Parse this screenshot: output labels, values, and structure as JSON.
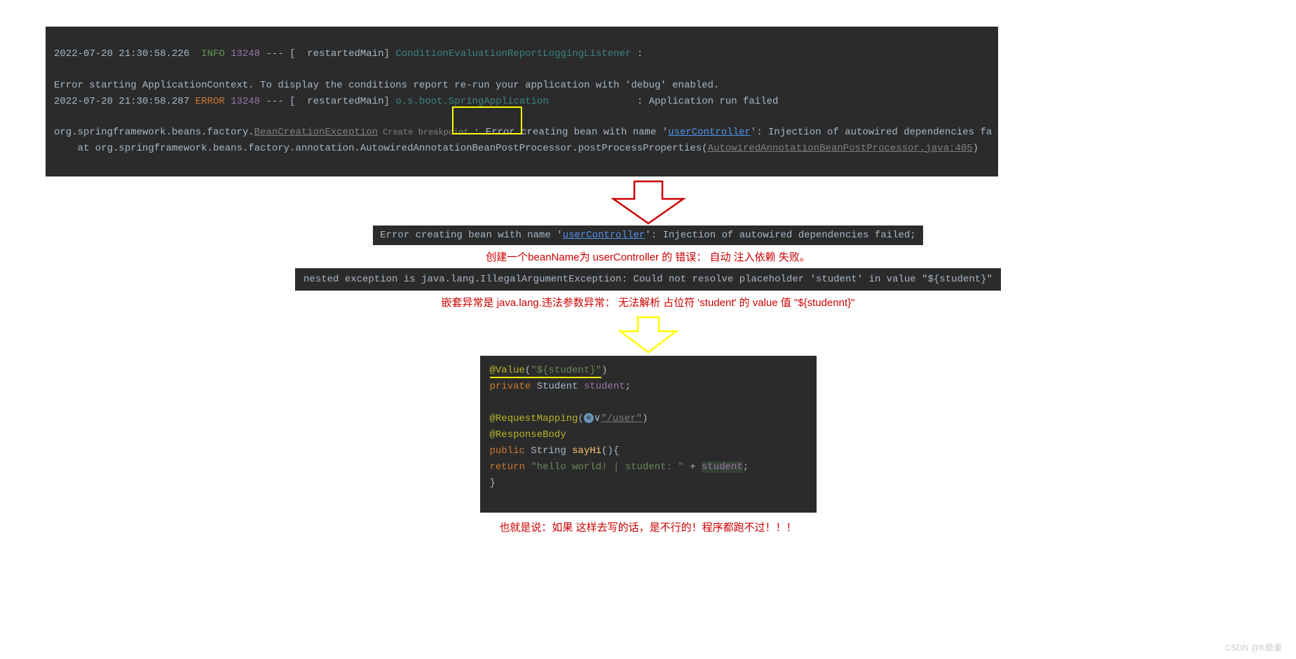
{
  "console": {
    "line1": {
      "ts": "2022-07-20 21:30:58.226",
      "level": "INFO",
      "pid": "13248",
      "sep": " --- [  restartedMain] ",
      "logger": "ConditionEvaluationReportLoggingListener",
      "msg": " : "
    },
    "line2": "Error starting ApplicationContext. To display the conditions report re-run your application with 'debug' enabled.",
    "line3": {
      "ts": "2022-07-20 21:30:58.287",
      "level": "ERROR",
      "pid": "13248",
      "sep": " --- [  restartedMain] ",
      "logger": "o.s.boot.SpringApplication",
      "pad": "               ",
      "msg": ": Application run failed"
    },
    "exc": {
      "prefix": "org.springframework.beans.factory.",
      "excName": "BeanCreationException",
      "breakpoint": " Create breakpoint ",
      "afterBp": ": Error creating bean with name '",
      "link": "userController",
      "suffix": "': Injection of autowired dependencies fa"
    },
    "stack": {
      "indent": "    at org.springframework.beans.factory.annotation.AutowiredAnnotationBeanPostProcessor.postProcessProperties(",
      "file": "AutowiredAnnotationBeanPostProcessor.java:405",
      "close": ")"
    }
  },
  "snippet1": {
    "pre": "Error creating bean with name '",
    "link": "userController",
    "post": "': Injection of autowired dependencies failed;"
  },
  "translation1": "创建一个beanName为 userController 的 错误：  自动 注入依赖 失败。",
  "snippet2": {
    "left": "nested exception is java.lang.IllegalArgumentException: Could not resolve ",
    "right": "placeholder 'student' in value \"${student}\""
  },
  "translation2": "嵌套异常是 java.lang.违法参数异常：  无法解析 占位符 'student' 的 value 值 \"${studennt}\"",
  "code": {
    "l1_anno": "@Value",
    "l1_paren_open": "(",
    "l1_str": "\"${student}\"",
    "l1_paren_close": ")",
    "l2_kw": "private",
    "l2_type": " Student ",
    "l2_var": "student",
    "l2_semi": ";",
    "l4_anno": "@RequestMapping",
    "l4_open": "(",
    "l4_str": "\"/user\"",
    "l4_close": ")",
    "l5_anno": "@ResponseBody",
    "l6_kw": "public",
    "l6_type": " String ",
    "l6_method": "sayHi",
    "l6_rest": "(){",
    "l7_kw": "return",
    "l7_str": " \"hello world! | student: \" ",
    "l7_plus": "+ ",
    "l7_var": "student",
    "l7_semi": ";",
    "l8": "}"
  },
  "translation3": "也就是说：如果 这样去写的话，是不行的！程序都跑不过！！！",
  "watermark": "CSDN @K稳重"
}
